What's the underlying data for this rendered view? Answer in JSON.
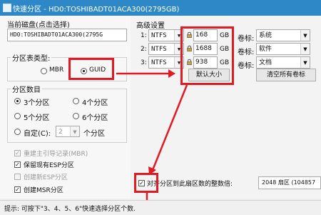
{
  "window": {
    "title": "快速分区 - HD0:TOSHIBADT01ACA300(2795GB)"
  },
  "disk": {
    "label": "当前磁盘(点击选择)",
    "value": "HD0:TOSHIBADT01ACA300(2795G"
  },
  "partition_type": {
    "label": "分区表类型:",
    "mbr": "MBR",
    "guid": "GUID",
    "selected": "GUID"
  },
  "partition_count": {
    "label": "分区数目",
    "options": [
      "3个分区",
      "4个分区",
      "5个分区",
      "6个分区"
    ],
    "custom_label": "自定(C):",
    "custom_value": "2",
    "custom_suffix": "个分区",
    "selected": "3个分区"
  },
  "options": {
    "rebuild_mbr": "重建主引导记录(MBR)",
    "keep_esp": "保留现有ESP分区",
    "create_esp": "创建新ESP分区",
    "create_msr": "创建MSR分区"
  },
  "advanced": {
    "label": "高级设置",
    "rows": [
      {
        "num": "1:",
        "fs": "NTFS",
        "size": "168",
        "unit": "GB",
        "vol_label": "卷标:",
        "vol_value": "系统"
      },
      {
        "num": "2:",
        "fs": "NTFS",
        "size": "1688",
        "unit": "GB",
        "vol_label": "卷标:",
        "vol_value": "软件"
      },
      {
        "num": "3:",
        "fs": "NTFS",
        "size": "938",
        "unit": "GB",
        "vol_label": "卷标:",
        "vol_value": "文档"
      }
    ],
    "default_size_button": "默认大小",
    "clear_labels_button": "清空所有卷标"
  },
  "align": {
    "label": "对齐分区到此扇区数的整数倍:",
    "value": "2048 扇区 (104857"
  },
  "status": {
    "text": "提示: 可按下\"3、4、5、6\"快速选择分区个数."
  }
}
